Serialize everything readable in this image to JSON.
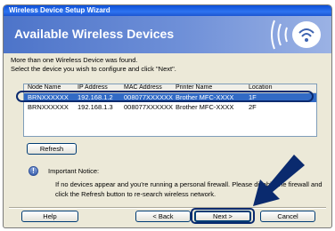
{
  "window": {
    "title": "Wireless Device Setup Wizard"
  },
  "banner": {
    "title": "Available Wireless Devices",
    "logo": "wifi-printer-logo"
  },
  "intro": {
    "line1": "More than one Wireless Device was found.",
    "line2": "Select the device you wish to configure and click \"Next\"."
  },
  "table": {
    "columns": [
      "Node Name",
      "IP Address",
      "MAC Address",
      "Printer Name",
      "Location"
    ],
    "rows": [
      {
        "node": "BRNXXXXXX",
        "ip": "192.168.1.2",
        "mac": "008077XXXXXX",
        "printer": "Brother MFC-XXXX",
        "location": "1F",
        "selected": true
      },
      {
        "node": "BRNXXXXXX",
        "ip": "192.168.1.3",
        "mac": "008077XXXXXX",
        "printer": "Brother MFC-XXXX",
        "location": "2F",
        "selected": false
      }
    ]
  },
  "buttons": {
    "refresh": "Refresh",
    "help": "Help",
    "back": "< Back",
    "next": "Next >",
    "cancel": "Cancel"
  },
  "notice": {
    "title": "Important Notice:",
    "text": "If no devices appear and you're running a personal firewall. Please disable the firewall and click the Refresh button to re-search wireless network."
  },
  "colors": {
    "selection": "#316ac5",
    "banner": "#5b7fcf",
    "callout": "#0a2a6e"
  }
}
